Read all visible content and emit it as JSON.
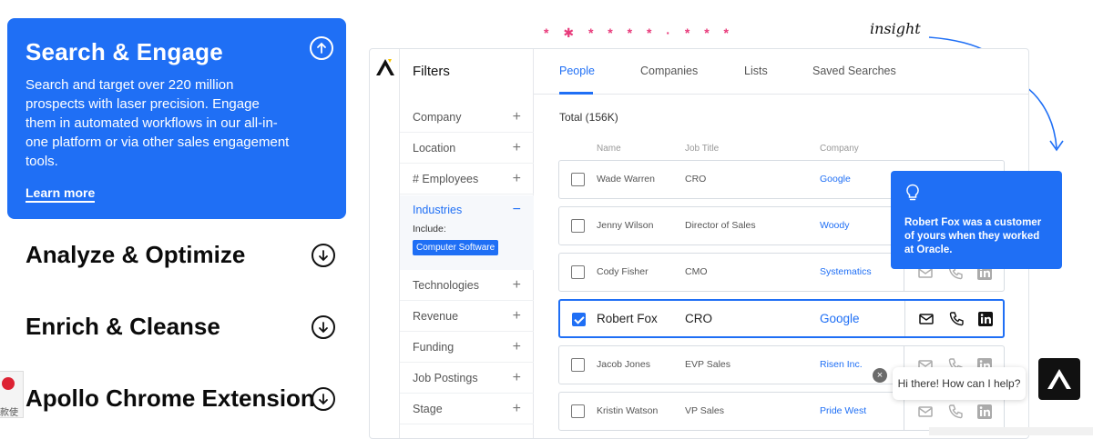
{
  "accordion": {
    "open_item": {
      "title": "Search & Engage",
      "body": "Search and target over 220 million prospects with laser precision. Engage them in automated workflows in our all-in-one platform or via other sales engagement tools.",
      "link": "Learn more"
    },
    "items": [
      {
        "title": "Analyze & Optimize"
      },
      {
        "title": "Enrich & Cleanse"
      },
      {
        "title": "Apollo Chrome Extension"
      }
    ]
  },
  "captcha": {
    "text": "款使"
  },
  "decor": {
    "stars": "* ✱ * * * * · * * *",
    "insight": "insight"
  },
  "app": {
    "filters_title": "Filters",
    "filters": [
      {
        "label": "Company",
        "sign": "+"
      },
      {
        "label": "Location",
        "sign": "+"
      },
      {
        "label": "# Employees",
        "sign": "+"
      },
      {
        "label": "Technologies",
        "sign": "+"
      },
      {
        "label": "Revenue",
        "sign": "+"
      },
      {
        "label": "Funding",
        "sign": "+"
      },
      {
        "label": "Job Postings",
        "sign": "+"
      },
      {
        "label": "Stage",
        "sign": "+"
      }
    ],
    "industries": {
      "label": "Industries",
      "sign": "−",
      "include": "Include:",
      "chip": "Computer Software"
    },
    "tabs": [
      {
        "label": "People",
        "active": true
      },
      {
        "label": "Companies"
      },
      {
        "label": "Lists"
      },
      {
        "label": "Saved Searches"
      }
    ],
    "total": "Total (156K)",
    "columns": {
      "name": "Name",
      "title": "Job Title",
      "company": "Company"
    },
    "rows": [
      {
        "name": "Wade Warren",
        "title": "CRO",
        "company": "Google"
      },
      {
        "name": "Jenny Wilson",
        "title": "Director of Sales",
        "company": "Woody"
      },
      {
        "name": "Cody Fisher",
        "title": "CMO",
        "company": "Systematics"
      },
      {
        "name": "Robert Fox",
        "title": "CRO",
        "company": "Google",
        "selected": true
      },
      {
        "name": "Jacob Jones",
        "title": "EVP Sales",
        "company": "Risen Inc."
      },
      {
        "name": "Kristin Watson",
        "title": "VP Sales",
        "company": "Pride West"
      }
    ]
  },
  "tooltip": {
    "text": "Robert Fox was a customer of yours when they worked at Oracle."
  },
  "chat": {
    "greeting": "Hi there! How can I help?",
    "close": "×"
  },
  "colors": {
    "brand_blue": "#1f6ff5",
    "accent_pink": "#e83b7b"
  }
}
